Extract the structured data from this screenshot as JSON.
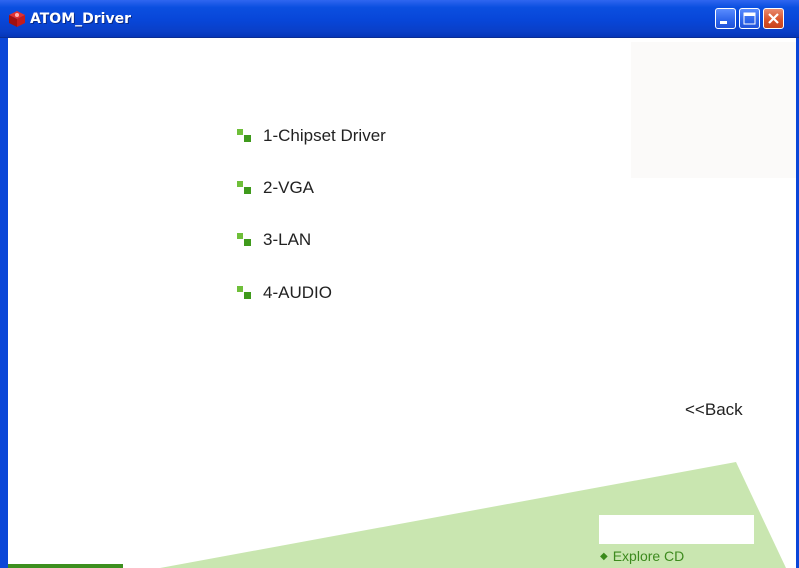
{
  "window": {
    "title": "ATOM_Driver",
    "icon": "red-cube-icon",
    "controls": [
      "minimize-icon",
      "maximize-icon",
      "close-icon"
    ]
  },
  "menu": {
    "items": [
      {
        "label": "1-Chipset Driver",
        "icon": "green-bullet-icon"
      },
      {
        "label": "2-VGA",
        "icon": "green-bullet-icon"
      },
      {
        "label": "3-LAN",
        "icon": "green-bullet-icon"
      },
      {
        "label": "4-AUDIO",
        "icon": "green-bullet-icon"
      }
    ]
  },
  "nav": {
    "back_label": "<<Back"
  },
  "footer": {
    "explore_bullet": "◆",
    "explore_label": "Explore CD"
  },
  "colors": {
    "titlebar": "#0846d8",
    "accent_green": "#6fbf3a",
    "decor_green": "#c9e6b0",
    "explore_text": "#3d8a1e"
  }
}
